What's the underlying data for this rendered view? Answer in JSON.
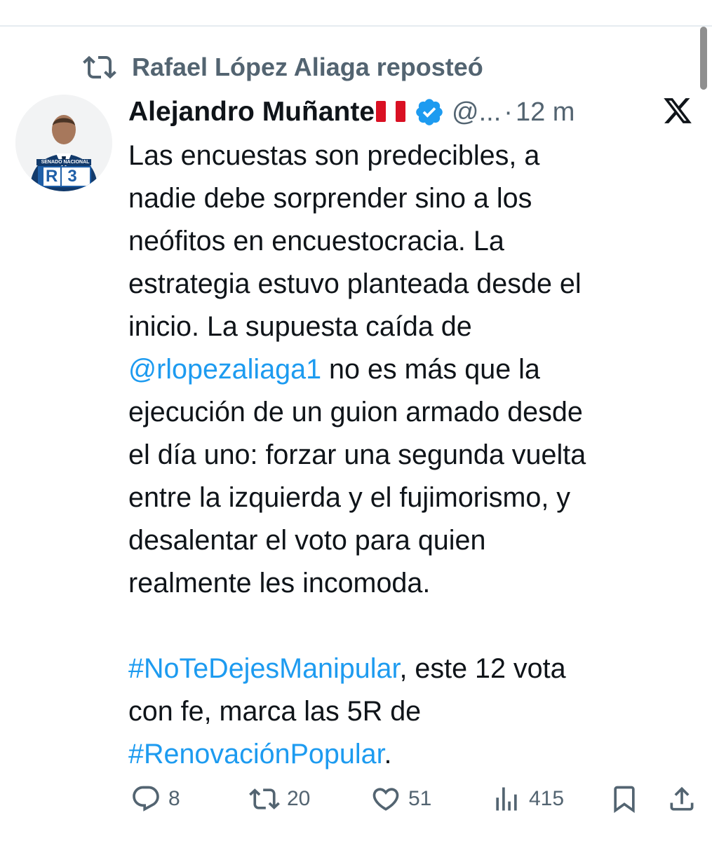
{
  "repost": {
    "icon": "repost-icon",
    "text": "Rafael López Aliaga reposteó"
  },
  "tweet": {
    "author": {
      "avatar_label": "SENADO NACIONAL",
      "avatar_badge": "R3",
      "display_name": "Alejandro Muñante",
      "flag": "peru-flag-icon",
      "verified": "verified-badge-icon",
      "handle": "@...",
      "separator": "·",
      "time": "12 m"
    },
    "platform_icon": "x-logo-icon",
    "text": {
      "line1": "Las encuestas son predecibles, a",
      "line2": "nadie debe sorprender sino a los",
      "line3": "neófitos en encuestocracia. La",
      "line4": "estrategia estuvo planteada desde el",
      "line5": "inicio. La supuesta caída de",
      "line6_mention": "@rlopezaliaga1",
      "line6_rest": " no es más que la",
      "line7": "ejecución de un guion armado desde",
      "line8": "el día uno: forzar una segunda vuelta",
      "line9": "entre la izquierda y el fujimorismo, y",
      "line10": "desalentar el voto para quien",
      "line11": "realmente les incomoda.",
      "line12_hashtag": "#NoTeDejesManipular",
      "line12_rest": ", este 12 vota",
      "line13": "con fe, marca las 5R de",
      "line14_hashtag": "#RenovaciónPopular",
      "line14_rest": "."
    },
    "actions": {
      "replies": "8",
      "reposts": "20",
      "likes": "51",
      "views": "415"
    }
  },
  "colors": {
    "link": "#1d9bf0",
    "secondary_text": "#536471",
    "primary_text": "#0f1419",
    "verified": "#1d9bf0"
  }
}
